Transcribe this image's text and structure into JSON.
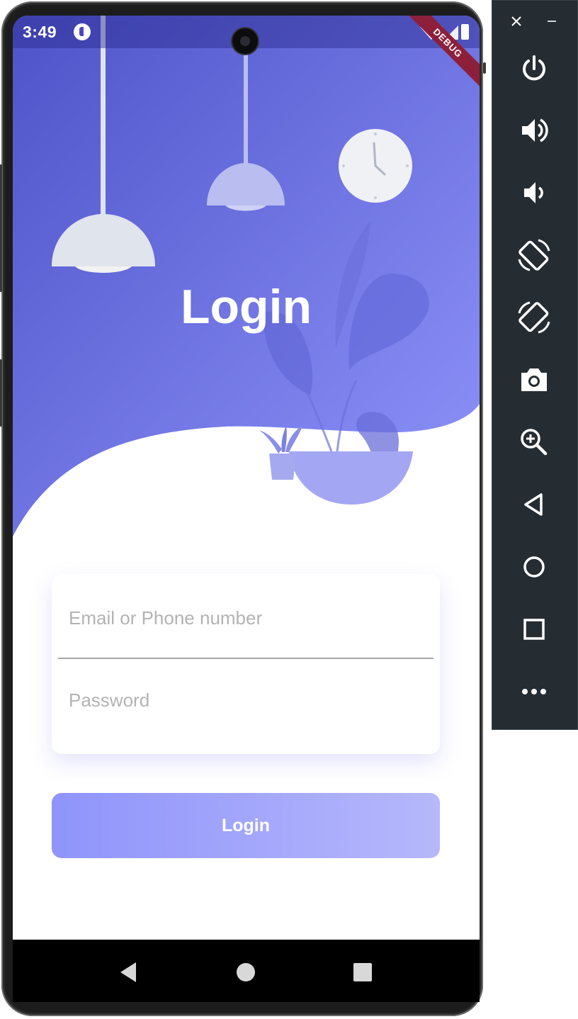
{
  "status_bar": {
    "time": "3:49",
    "icons": [
      "app-notification-icon",
      "wifi-icon",
      "signal-icon",
      "battery-icon"
    ]
  },
  "debug_banner": "DEBUG",
  "header": {
    "title": "Login",
    "gradient_colors": [
      "#4e54c8",
      "#8f94fb"
    ],
    "illustration": [
      "pendant-lamp-icon",
      "pendant-lamp-icon",
      "wall-clock-icon",
      "potted-plant-icon",
      "small-plant-icon"
    ]
  },
  "form": {
    "email": {
      "placeholder": "Email or Phone number",
      "value": ""
    },
    "password": {
      "placeholder": "Password",
      "value": ""
    }
  },
  "login_button": {
    "label": "Login"
  },
  "nav_bar": {
    "buttons": [
      "back-icon",
      "home-icon",
      "recents-icon"
    ]
  },
  "emulator_toolbar": {
    "window_controls": [
      "close-icon",
      "minimize-icon"
    ],
    "buttons": [
      "power-icon",
      "volume-up-icon",
      "volume-down-icon",
      "rotate-left-icon",
      "rotate-right-icon",
      "camera-icon",
      "zoom-icon",
      "back-icon",
      "home-icon",
      "overview-icon",
      "more-icon"
    ]
  }
}
